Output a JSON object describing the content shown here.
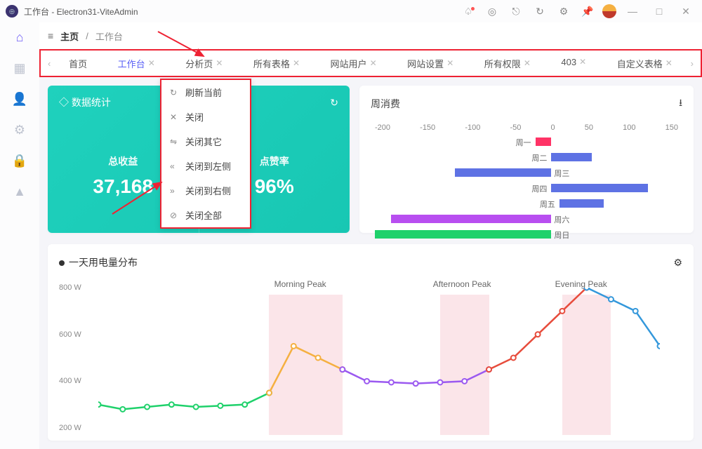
{
  "titlebar": {
    "title": "工作台 - Electron31-ViteAdmin"
  },
  "breadcrumb": {
    "root": "主页",
    "current": "工作台"
  },
  "tabs": [
    {
      "label": "首页",
      "closable": false,
      "active": false
    },
    {
      "label": "工作台",
      "closable": true,
      "active": true
    },
    {
      "label": "分析页",
      "closable": true,
      "active": false
    },
    {
      "label": "所有表格",
      "closable": true,
      "active": false
    },
    {
      "label": "网站用户",
      "closable": true,
      "active": false
    },
    {
      "label": "网站设置",
      "closable": true,
      "active": false
    },
    {
      "label": "所有权限",
      "closable": true,
      "active": false
    },
    {
      "label": "403",
      "closable": true,
      "active": false
    },
    {
      "label": "自定义表格",
      "closable": true,
      "active": false
    }
  ],
  "context_menu": [
    {
      "icon": "↻",
      "label": "刷新当前"
    },
    {
      "icon": "✕",
      "label": "关闭"
    },
    {
      "icon": "⇋",
      "label": "关闭其它"
    },
    {
      "icon": "«",
      "label": "关闭到左侧"
    },
    {
      "icon": "»",
      "label": "关闭到右侧"
    },
    {
      "icon": "⊘",
      "label": "关闭全部"
    }
  ],
  "stats_card": {
    "title": "数据统计",
    "col1": {
      "label": "总收益",
      "value": "37,168"
    },
    "col2": {
      "label": "点赞率",
      "value": "96%"
    }
  },
  "week_card": {
    "title": "周消费",
    "axis": [
      "-200",
      "-150",
      "-100",
      "-50",
      "0",
      "50",
      "100",
      "150"
    ]
  },
  "chart_card": {
    "title": "一天用电量分布",
    "peaks": [
      "Morning Peak",
      "Afternoon Peak",
      "Evening Peak"
    ]
  },
  "chart_data": [
    {
      "type": "bar",
      "title": "周消费",
      "xlim": [
        -200,
        150
      ],
      "series": [
        {
          "name": "周一",
          "color": "#f36",
          "range": [
            0,
            20
          ]
        },
        {
          "name": "周二",
          "color": "#5e72e4",
          "range": [
            20,
            70
          ]
        },
        {
          "name": "周三",
          "color": "#5e72e4",
          "range": [
            -100,
            20
          ]
        },
        {
          "name": "周四",
          "color": "#5e72e4",
          "range": [
            20,
            140
          ]
        },
        {
          "name": "周五",
          "color": "#5e72e4",
          "range": [
            30,
            85
          ]
        },
        {
          "name": "周六",
          "color": "#b84ef0",
          "range": [
            -180,
            20
          ]
        },
        {
          "name": "周日",
          "color": "#1fd16b",
          "range": [
            -200,
            20
          ]
        }
      ]
    },
    {
      "type": "line",
      "title": "一天用电量分布",
      "ylabel": "W",
      "ylim": [
        200,
        800
      ],
      "yticks": [
        200,
        400,
        600,
        800
      ],
      "x": [
        0,
        1,
        2,
        3,
        4,
        5,
        6,
        7,
        8,
        9,
        10,
        11,
        12,
        13,
        14,
        15,
        16,
        17,
        18,
        19,
        20,
        21,
        22,
        23
      ],
      "series": [
        {
          "name": "power",
          "values": [
            300,
            280,
            290,
            300,
            290,
            295,
            300,
            350,
            550,
            500,
            450,
            400,
            395,
            390,
            395,
            400,
            450,
            500,
            600,
            700,
            800,
            750,
            700,
            550
          ]
        }
      ],
      "segment_colors": [
        {
          "from": 0,
          "to": 7,
          "color": "#1fd16b"
        },
        {
          "from": 7,
          "to": 10,
          "color": "#f5b041"
        },
        {
          "from": 10,
          "to": 16,
          "color": "#9b59f0"
        },
        {
          "from": 16,
          "to": 20,
          "color": "#e74c3c"
        },
        {
          "from": 20,
          "to": 23,
          "color": "#3498db"
        }
      ],
      "annotations": [
        {
          "label": "Morning Peak",
          "x_range": [
            7,
            10
          ]
        },
        {
          "label": "Afternoon Peak",
          "x_range": [
            14,
            16
          ]
        },
        {
          "label": "Evening Peak",
          "x_range": [
            19,
            21
          ]
        }
      ]
    }
  ]
}
